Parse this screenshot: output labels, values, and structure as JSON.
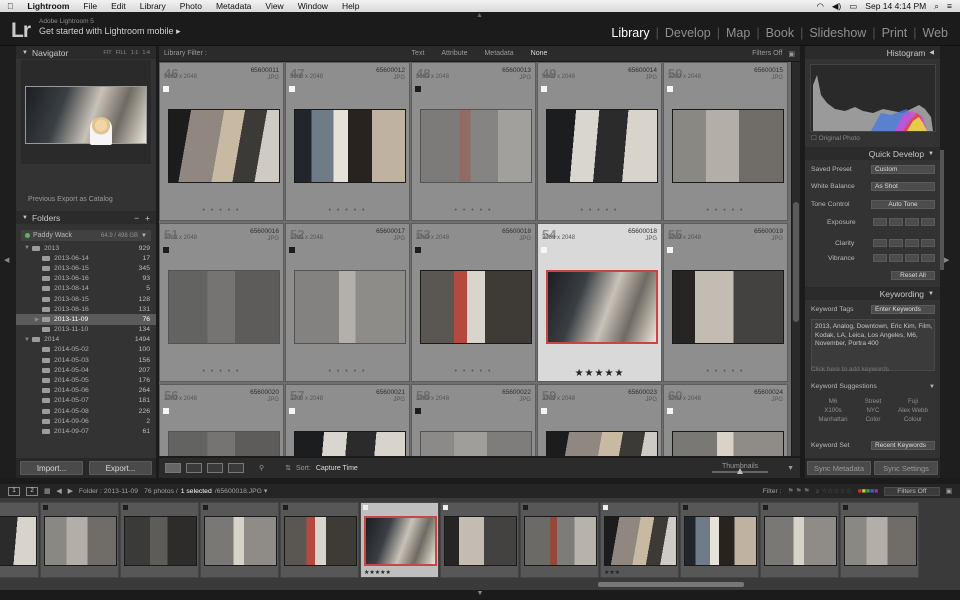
{
  "menubar": {
    "app": "Lightroom",
    "items": [
      "File",
      "Edit",
      "Library",
      "Photo",
      "Metadata",
      "View",
      "Window",
      "Help"
    ],
    "datetime": "Sep 14  4:14 PM"
  },
  "identity": {
    "logo": "Lr",
    "product": "Adobe Lightroom 5",
    "mobile_label": "Get started with Lightroom mobile",
    "modules": [
      "Library",
      "Develop",
      "Map",
      "Book",
      "Slideshow",
      "Print",
      "Web"
    ],
    "active_module": "Library"
  },
  "left_panel": {
    "navigator": {
      "title": "Navigator",
      "options": [
        "FIT",
        "FILL",
        "1:1",
        "1:4"
      ]
    },
    "previous_export": "Previous Export as Catalog",
    "folders": {
      "title": "Folders",
      "volume": "Paddy Wack",
      "volume_size": "64.9 / 498 GB"
    },
    "folder_list": [
      {
        "name": "2013",
        "count": "929",
        "level": 1,
        "arrow": "▼"
      },
      {
        "name": "2013-06-14",
        "count": "17",
        "level": 2,
        "arrow": ""
      },
      {
        "name": "2013-06-15",
        "count": "345",
        "level": 2,
        "arrow": ""
      },
      {
        "name": "2013-06-16",
        "count": "93",
        "level": 2,
        "arrow": ""
      },
      {
        "name": "2013-08-14",
        "count": "5",
        "level": 2,
        "arrow": ""
      },
      {
        "name": "2013-08-15",
        "count": "128",
        "level": 2,
        "arrow": ""
      },
      {
        "name": "2013-08-16",
        "count": "131",
        "level": 2,
        "arrow": ""
      },
      {
        "name": "2013-11-09",
        "count": "76",
        "level": 2,
        "arrow": "▶",
        "selected": true
      },
      {
        "name": "2013-11-10",
        "count": "134",
        "level": 2,
        "arrow": ""
      },
      {
        "name": "2014",
        "count": "1494",
        "level": 1,
        "arrow": "▼"
      },
      {
        "name": "2014-05-02",
        "count": "100",
        "level": 2,
        "arrow": ""
      },
      {
        "name": "2014-05-03",
        "count": "156",
        "level": 2,
        "arrow": ""
      },
      {
        "name": "2014-05-04",
        "count": "207",
        "level": 2,
        "arrow": ""
      },
      {
        "name": "2014-05-05",
        "count": "176",
        "level": 2,
        "arrow": ""
      },
      {
        "name": "2014-05-06",
        "count": "264",
        "level": 2,
        "arrow": ""
      },
      {
        "name": "2014-05-07",
        "count": "181",
        "level": 2,
        "arrow": ""
      },
      {
        "name": "2014-05-08",
        "count": "226",
        "level": 2,
        "arrow": ""
      },
      {
        "name": "2014-09-06",
        "count": "2",
        "level": 2,
        "arrow": ""
      },
      {
        "name": "2014-09-07",
        "count": "61",
        "level": 2,
        "arrow": ""
      }
    ],
    "import_label": "Import...",
    "export_label": "Export..."
  },
  "filter_bar": {
    "title": "Library Filter :",
    "options": [
      "Text",
      "Attribute",
      "Metadata",
      "None"
    ],
    "active": "None",
    "filters_off": "Filters Off"
  },
  "grid": {
    "cells": [
      {
        "num": "46",
        "fn": "65600011",
        "dim": "3089 x 2048",
        "ext": "JPG",
        "thumb": "t1",
        "flag": "white",
        "dots": "• • • • •",
        "dimmed": false
      },
      {
        "num": "47",
        "fn": "65600012",
        "dim": "3089 x 2048",
        "ext": "JPG",
        "thumb": "t2",
        "flag": "white",
        "dots": "• • • • •",
        "dimmed": false
      },
      {
        "num": "48",
        "fn": "65600013",
        "dim": "3089 x 2048",
        "ext": "JPG",
        "thumb": "t3",
        "flag": "black",
        "dots": "• • • • •",
        "dimmed": true
      },
      {
        "num": "49",
        "fn": "65600014",
        "dim": "3089 x 2048",
        "ext": "JPG",
        "thumb": "t4",
        "flag": "white",
        "dots": "• • • • •",
        "dimmed": false
      },
      {
        "num": "50",
        "fn": "65600015",
        "dim": "3089 x 2048",
        "ext": "JPG",
        "thumb": "t5",
        "flag": "white",
        "dots": "• • • • •",
        "dimmed": false
      },
      {
        "num": "51",
        "fn": "65600016",
        "dim": "3089 x 2048",
        "ext": "JPG",
        "thumb": "t6",
        "flag": "black",
        "dots": "• • • • •",
        "dimmed": true
      },
      {
        "num": "52",
        "fn": "65600017",
        "dim": "3089 x 2048",
        "ext": "JPG",
        "thumb": "t7",
        "flag": "black",
        "dots": "• • • • •",
        "dimmed": true
      },
      {
        "num": "53",
        "fn": "65600018",
        "dim": "3089 x 2048",
        "ext": "JPG",
        "thumb": "t8",
        "flag": "black",
        "dots": "• • • • •",
        "dimmed": false
      },
      {
        "num": "54",
        "fn": "65600018",
        "dim": "3089 x 2048",
        "ext": "JPG",
        "thumb": "t9",
        "flag": "white",
        "dots": "",
        "stars": "★★★★★",
        "selected": true,
        "dimmed": false
      },
      {
        "num": "55",
        "fn": "65600019",
        "dim": "3089 x 2048",
        "ext": "JPG",
        "thumb": "t10",
        "flag": "white",
        "dots": "• • • • •",
        "dimmed": false
      },
      {
        "num": "56",
        "fn": "65600020",
        "dim": "3089 x 2048",
        "ext": "JPG",
        "thumb": "t6",
        "flag": "white",
        "dots": "",
        "dimmed": true
      },
      {
        "num": "57",
        "fn": "65600021",
        "dim": "3089 x 2048",
        "ext": "JPG",
        "thumb": "t4",
        "flag": "white",
        "dots": "",
        "dimmed": false
      },
      {
        "num": "58",
        "fn": "65600022",
        "dim": "3089 x 2048",
        "ext": "JPG",
        "thumb": "t5",
        "flag": "black",
        "dots": "",
        "dimmed": true
      },
      {
        "num": "59",
        "fn": "65600023",
        "dim": "3089 x 2048",
        "ext": "JPG",
        "thumb": "t1",
        "flag": "white",
        "dots": "",
        "dimmed": false
      },
      {
        "num": "60",
        "fn": "65600024",
        "dim": "3089 x 2048",
        "ext": "JPG",
        "thumb": "t7",
        "flag": "white",
        "dots": "",
        "dimmed": false
      }
    ]
  },
  "toolbar": {
    "sort_label": "Sort:",
    "sort_value": "Capture Time",
    "thumbnails_label": "Thumbnails"
  },
  "right_panel": {
    "histogram_title": "Histogram",
    "original_photo": "Original Photo",
    "quick_develop_title": "Quick Develop",
    "saved_preset_label": "Saved Preset",
    "saved_preset_value": "Custom",
    "white_balance_label": "White Balance",
    "white_balance_value": "As Shot",
    "tone_control_label": "Tone Control",
    "auto_tone": "Auto Tone",
    "exposure_label": "Exposure",
    "clarity_label": "Clarity",
    "vibrance_label": "Vibrance",
    "reset_all": "Reset All",
    "keywording_title": "Keywording",
    "keyword_tags_label": "Keyword Tags",
    "keyword_tags_value": "Enter Keywords",
    "keywords": "2013, Analog, Downtown, Eric Kim, Film, Kodak, LA, Leica, Los Angeles, M6, November, Portra 400",
    "add_keywords_hint": "Click here to add keywords",
    "keyword_suggestions_label": "Keyword Suggestions",
    "suggestions": [
      "M6",
      "Street",
      "Fuji",
      "X100s",
      "NYC",
      "Alex Webb",
      "Manhattan",
      "Color",
      "Colour"
    ],
    "keyword_set_label": "Keyword Set",
    "keyword_set_value": "Recent Keywords",
    "sync_metadata": "Sync Metadata",
    "sync_settings": "Sync Settings"
  },
  "filmstrip_bar": {
    "folder_text": "Folder : 2013-11-09",
    "photo_count": "76 photos /",
    "selected": "1 selected",
    "filename": "/65600018.JPG ▾",
    "filter_label": "Filter :",
    "filters_off": "Filters Off"
  },
  "filmstrip": {
    "frames": [
      {
        "thumb": "t4",
        "flag": "white",
        "stars": ""
      },
      {
        "thumb": "t5",
        "flag": "black",
        "stars": ""
      },
      {
        "thumb": "t6",
        "flag": "black",
        "stars": ""
      },
      {
        "thumb": "t7",
        "flag": "black",
        "stars": ""
      },
      {
        "thumb": "t8",
        "flag": "black",
        "stars": ""
      },
      {
        "thumb": "t9",
        "flag": "white",
        "stars": "★★★★★",
        "selected": true
      },
      {
        "thumb": "t10",
        "flag": "white",
        "stars": ""
      },
      {
        "thumb": "t3",
        "flag": "black",
        "stars": ""
      },
      {
        "thumb": "t1",
        "flag": "white",
        "stars": "★★★"
      },
      {
        "thumb": "t2",
        "flag": "black",
        "stars": ""
      },
      {
        "thumb": "t7",
        "flag": "black",
        "stars": ""
      },
      {
        "thumb": "t5",
        "flag": "black",
        "stars": ""
      }
    ]
  },
  "colors": {
    "selection_red": "#c84545",
    "grid_bg": "#6e6e6e",
    "panel_bg": "#333333"
  }
}
